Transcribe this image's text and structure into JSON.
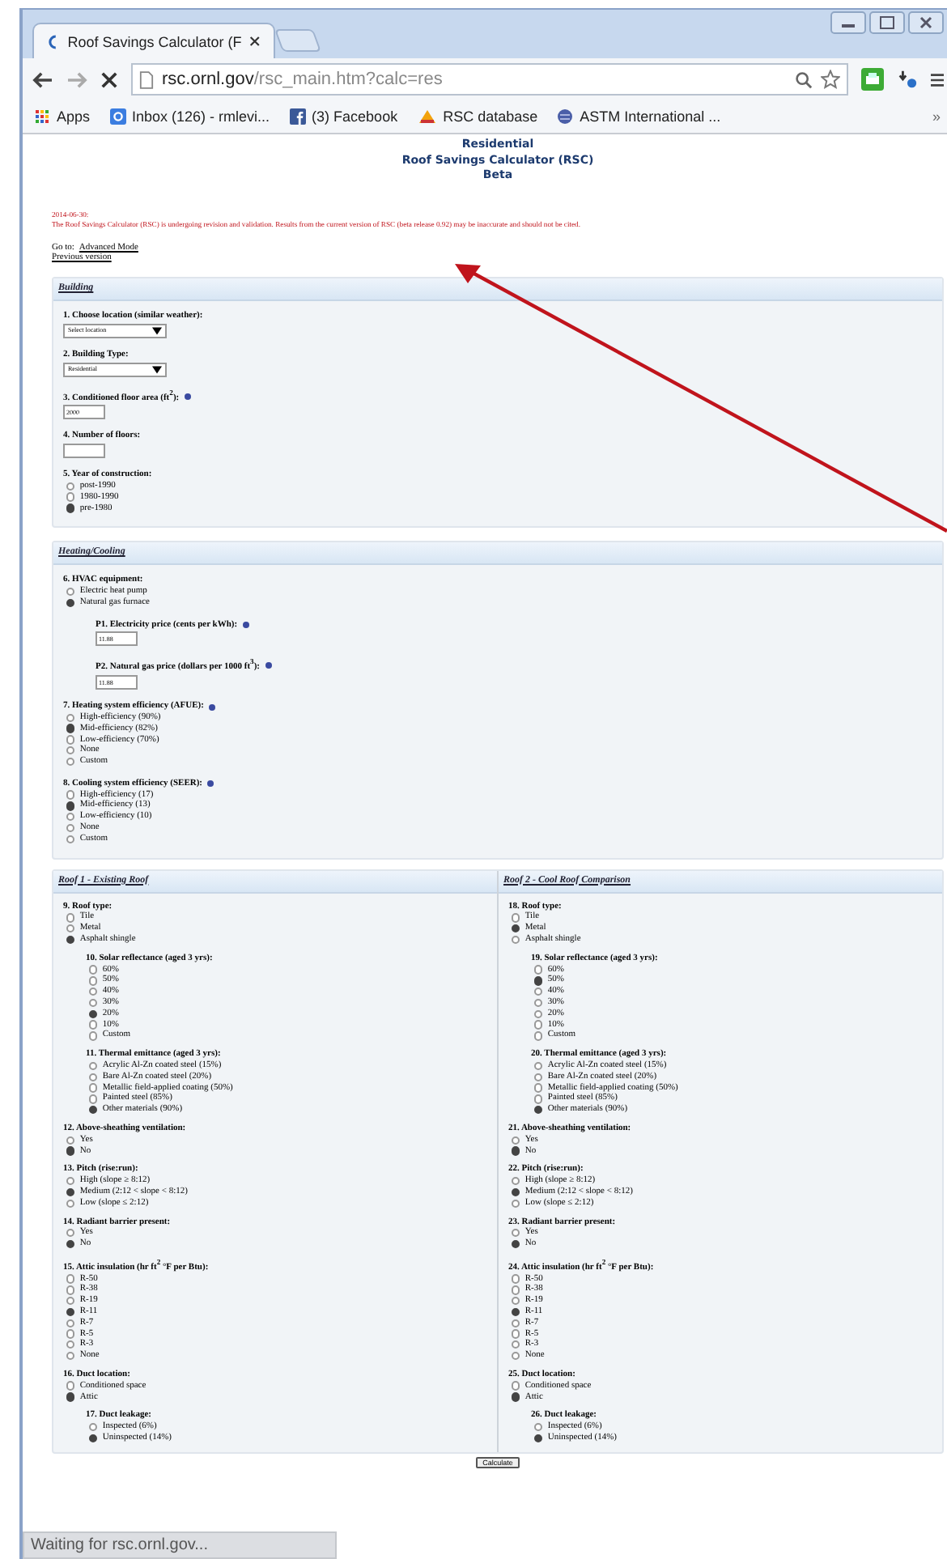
{
  "browser": {
    "tab_title": "Roof Savings Calculator (F",
    "address_domain": "rsc.ornl.gov",
    "address_path": "/rsc_main.htm?calc=res",
    "bookmarks": [
      {
        "label": "Apps",
        "kind": "apps"
      },
      {
        "label": "Inbox (126) - rmlevi...",
        "kind": "mail"
      },
      {
        "label": "(3) Facebook",
        "kind": "facebook"
      },
      {
        "label": "RSC database",
        "kind": "db"
      },
      {
        "label": "ASTM International ...",
        "kind": "globe"
      }
    ],
    "more": "»"
  },
  "page": {
    "title_lines": [
      "Residential",
      "Roof Savings Calculator (RSC)",
      "Beta"
    ],
    "notice_date": "2014-06-30:",
    "notice": "The Roof Savings Calculator (RSC) is undergoing revision and validation. Results from the current version of RSC (beta release 0.92) may be inaccurate and should not be cited.",
    "goto_label": "Go to:",
    "links": [
      "Advanced Mode",
      "Previous version"
    ]
  },
  "sections": [
    {
      "title": "Building",
      "questions": [
        {
          "kind": "select",
          "label": "1. Choose location (similar weather):",
          "info": false,
          "value": "Select location"
        },
        {
          "kind": "select",
          "label": "2. Building Type:",
          "info": false,
          "value": "Residential"
        },
        {
          "kind": "text",
          "label": "3. Conditioned floor area (ft$^{2}$):",
          "info": true,
          "value": "2000"
        },
        {
          "kind": "text",
          "label": "4. Number of floors:",
          "info": false
        },
        {
          "kind": "radio",
          "label": "5. Year of construction:",
          "info": false,
          "options": [
            {
              "label": "post-1990",
              "selected": false
            },
            {
              "label": "1980-1990",
              "selected": false
            },
            {
              "label": "pre-1980",
              "selected": true
            }
          ]
        }
      ]
    },
    {
      "title": "Heating/Cooling",
      "questions": [
        {
          "kind": "radio",
          "label": "6. HVAC equipment:",
          "info": false,
          "options": [
            {
              "label": "Electric heat pump",
              "selected": false
            },
            {
              "label": "Natural gas furnace",
              "selected": true
            }
          ],
          "sub": [
            {
              "kind": "text",
              "label": "P1. Electricity price (cents per kWh):",
              "info": true,
              "value": "11.88"
            },
            {
              "kind": "text",
              "label": "P2. Natural gas price (dollars per 1000 ft$^{3}$):",
              "info": true,
              "value": "11.88"
            }
          ]
        },
        {
          "kind": "radio",
          "label": "7. Heating system efficiency (AFUE):",
          "info": true,
          "options": [
            {
              "label": "High-efficiency (90%)",
              "selected": false
            },
            {
              "label": "Mid-efficiency (82%)",
              "selected": true
            },
            {
              "label": "Low-efficiency (70%)",
              "selected": false
            },
            {
              "label": "None",
              "selected": false
            },
            {
              "label": "Custom",
              "selected": false
            }
          ]
        },
        {
          "kind": "radio",
          "label": "8. Cooling system efficiency (SEER):",
          "info": true,
          "options": [
            {
              "label": "High-efficiency (17)",
              "selected": false
            },
            {
              "label": "Mid-efficiency (13)",
              "selected": true
            },
            {
              "label": "Low-efficiency (10)",
              "selected": false
            },
            {
              "label": "None",
              "selected": false
            },
            {
              "label": "Custom",
              "selected": false
            }
          ]
        }
      ]
    }
  ],
  "roofs": [
    {
      "title": "Roof 1 - Existing Roof",
      "questions": [
        {
          "kind": "radio",
          "label": "9. Roof type:",
          "info": false,
          "options": [
            {
              "label": "Tile",
              "selected": false
            },
            {
              "label": "Metal",
              "selected": false
            },
            {
              "label": "Asphalt shingle",
              "selected": true
            }
          ],
          "sub": [
            {
              "kind": "radio",
              "label": "10. Solar reflectance (aged 3 yrs):",
              "info": false,
              "options": [
                {
                  "label": "60%",
                  "selected": false
                },
                {
                  "label": "50%",
                  "selected": false
                },
                {
                  "label": "40%",
                  "selected": false
                },
                {
                  "label": "30%",
                  "selected": false
                },
                {
                  "label": "20%",
                  "selected": true
                },
                {
                  "label": "10%",
                  "selected": false
                },
                {
                  "label": "Custom",
                  "selected": false
                }
              ]
            },
            {
              "kind": "radio",
              "label": "11. Thermal emittance (aged 3 yrs):",
              "info": false,
              "options": [
                {
                  "label": "Acrylic Al-Zn coated steel (15%)",
                  "selected": false
                },
                {
                  "label": "Bare Al-Zn coated steel (20%)",
                  "selected": false
                },
                {
                  "label": "Metallic field-applied coating (50%)",
                  "selected": false
                },
                {
                  "label": "Painted steel (85%)",
                  "selected": false
                },
                {
                  "label": "Other materials (90%)",
                  "selected": true
                }
              ]
            }
          ]
        },
        {
          "kind": "radio",
          "label": "12. Above-sheathing ventilation:",
          "info": false,
          "options": [
            {
              "label": "Yes",
              "selected": false
            },
            {
              "label": "No",
              "selected": true
            }
          ]
        },
        {
          "kind": "radio",
          "label": "13. Pitch (rise:run):",
          "info": false,
          "options": [
            {
              "label": "High (slope ≥ 8:12)",
              "selected": false
            },
            {
              "label": "Medium (2:12 < slope < 8:12)",
              "selected": true
            },
            {
              "label": "Low (slope ≤ 2:12)",
              "selected": false
            }
          ]
        },
        {
          "kind": "radio",
          "label": "14. Radiant barrier present:",
          "info": false,
          "options": [
            {
              "label": "Yes",
              "selected": false
            },
            {
              "label": "No",
              "selected": true
            }
          ]
        },
        {
          "kind": "radio",
          "label": "15. Attic insulation (hr ft$^{2}$ °F per Btu):",
          "info": false,
          "options": [
            {
              "label": "R-50",
              "selected": false
            },
            {
              "label": "R-38",
              "selected": false
            },
            {
              "label": "R-19",
              "selected": false
            },
            {
              "label": "R-11",
              "selected": true
            },
            {
              "label": "R-7",
              "selected": false
            },
            {
              "label": "R-5",
              "selected": false
            },
            {
              "label": "R-3",
              "selected": false
            },
            {
              "label": "None",
              "selected": false
            }
          ]
        },
        {
          "kind": "radio",
          "label": "16. Duct location:",
          "info": false,
          "options": [
            {
              "label": "Conditioned space",
              "selected": false
            },
            {
              "label": "Attic",
              "selected": true
            }
          ],
          "sub": [
            {
              "kind": "radio",
              "label": "17. Duct leakage:",
              "info": false,
              "options": [
                {
                  "label": "Inspected (6%)",
                  "selected": false
                },
                {
                  "label": "Uninspected (14%)",
                  "selected": true
                }
              ]
            }
          ]
        }
      ]
    },
    {
      "title": "Roof 2 - Cool Roof Comparison",
      "questions": [
        {
          "kind": "radio",
          "label": "18. Roof type:",
          "info": false,
          "options": [
            {
              "label": "Tile",
              "selected": false
            },
            {
              "label": "Metal",
              "selected": true
            },
            {
              "label": "Asphalt shingle",
              "selected": false
            }
          ],
          "sub": [
            {
              "kind": "radio",
              "label": "19. Solar reflectance (aged 3 yrs):",
              "info": false,
              "options": [
                {
                  "label": "60%",
                  "selected": false
                },
                {
                  "label": "50%",
                  "selected": true
                },
                {
                  "label": "40%",
                  "selected": false
                },
                {
                  "label": "30%",
                  "selected": false
                },
                {
                  "label": "20%",
                  "selected": false
                },
                {
                  "label": "10%",
                  "selected": false
                },
                {
                  "label": "Custom",
                  "selected": false
                }
              ]
            },
            {
              "kind": "radio",
              "label": "20. Thermal emittance (aged 3 yrs):",
              "info": false,
              "options": [
                {
                  "label": "Acrylic Al-Zn coated steel (15%)",
                  "selected": false
                },
                {
                  "label": "Bare Al-Zn coated steel (20%)",
                  "selected": false
                },
                {
                  "label": "Metallic field-applied coating (50%)",
                  "selected": false
                },
                {
                  "label": "Painted steel (85%)",
                  "selected": false
                },
                {
                  "label": "Other materials (90%)",
                  "selected": true
                }
              ]
            }
          ]
        },
        {
          "kind": "radio",
          "label": "21. Above-sheathing ventilation:",
          "info": false,
          "options": [
            {
              "label": "Yes",
              "selected": false
            },
            {
              "label": "No",
              "selected": true
            }
          ]
        },
        {
          "kind": "radio",
          "label": "22. Pitch (rise:run):",
          "info": false,
          "options": [
            {
              "label": "High (slope ≥ 8:12)",
              "selected": false
            },
            {
              "label": "Medium (2:12 < slope < 8:12)",
              "selected": true
            },
            {
              "label": "Low (slope ≤ 2:12)",
              "selected": false
            }
          ]
        },
        {
          "kind": "radio",
          "label": "23. Radiant barrier present:",
          "info": false,
          "options": [
            {
              "label": "Yes",
              "selected": false
            },
            {
              "label": "No",
              "selected": true
            }
          ]
        },
        {
          "kind": "radio",
          "label": "24. Attic insulation (hr ft$^{2}$ °F per Btu):",
          "info": false,
          "options": [
            {
              "label": "R-50",
              "selected": false
            },
            {
              "label": "R-38",
              "selected": false
            },
            {
              "label": "R-19",
              "selected": false
            },
            {
              "label": "R-11",
              "selected": true
            },
            {
              "label": "R-7",
              "selected": false
            },
            {
              "label": "R-5",
              "selected": false
            },
            {
              "label": "R-3",
              "selected": false
            },
            {
              "label": "None",
              "selected": false
            }
          ]
        },
        {
          "kind": "radio",
          "label": "25. Duct location:",
          "info": false,
          "options": [
            {
              "label": "Conditioned space",
              "selected": false
            },
            {
              "label": "Attic",
              "selected": true
            }
          ],
          "sub": [
            {
              "kind": "radio",
              "label": "26. Duct leakage:",
              "info": false,
              "options": [
                {
                  "label": "Inspected (6%)",
                  "selected": false
                },
                {
                  "label": "Uninspected (14%)",
                  "selected": true
                }
              ]
            }
          ]
        }
      ]
    }
  ],
  "calculate": "Calculate",
  "status": "Waiting for rsc.ornl.gov..."
}
